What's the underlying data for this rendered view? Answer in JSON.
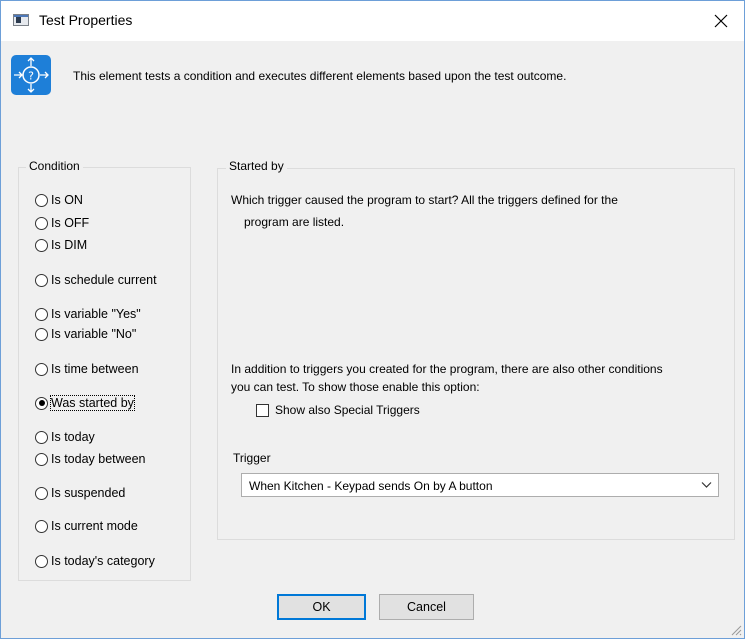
{
  "window": {
    "title": "Test Properties",
    "close_glyph": "×"
  },
  "header": {
    "icon": "test-element-icon",
    "description": "This element tests a condition and executes different elements based upon the test outcome."
  },
  "condition_group": {
    "title": "Condition",
    "options": [
      {
        "label": "Is ON",
        "checked": false
      },
      {
        "label": "Is OFF",
        "checked": false
      },
      {
        "label": "Is DIM",
        "checked": false
      },
      {
        "label": "Is schedule current",
        "checked": false
      },
      {
        "label": "Is variable \"Yes\"",
        "checked": false
      },
      {
        "label": "Is variable \"No\"",
        "checked": false
      },
      {
        "label": "Is time between",
        "checked": false
      },
      {
        "label": "Was started by",
        "checked": true
      },
      {
        "label": "Is today",
        "checked": false
      },
      {
        "label": "Is today between",
        "checked": false
      },
      {
        "label": "Is suspended",
        "checked": false
      },
      {
        "label": "Is current mode",
        "checked": false
      },
      {
        "label": "Is today's category",
        "checked": false
      }
    ]
  },
  "started_by_group": {
    "title": "Started by",
    "question_line1": "Which trigger caused the program to start?  All the triggers defined for the",
    "question_line2": "program are listed.",
    "info_line1": "In addition to triggers you created for the program, there are also other conditions",
    "info_line2": "you can test.  To show those enable this option:",
    "special_triggers_label": "Show also Special Triggers",
    "special_triggers_checked": false,
    "trigger_label": "Trigger",
    "trigger_value": "When Kitchen - Keypad sends On by A button"
  },
  "buttons": {
    "ok": "OK",
    "cancel": "Cancel"
  },
  "colors": {
    "accent": "#0078d7",
    "header_icon_bg": "#1e7fd8",
    "window_border": "#6d9fd8"
  }
}
